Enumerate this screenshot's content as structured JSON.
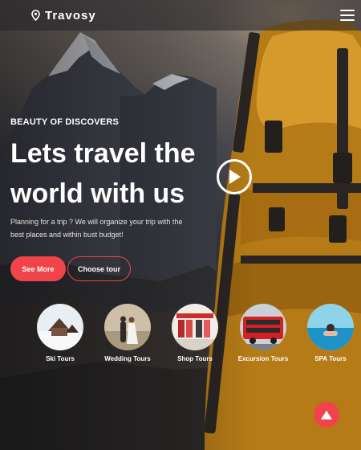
{
  "brand": {
    "name": "Travosy"
  },
  "hero": {
    "eyebrow": "BEAUTY OF DISCOVERS",
    "headline": "Lets travel the world with us",
    "description": "Planning for a trip ? We will organize your trip with the best places and within bust budget!",
    "primary_button": "See More",
    "secondary_button": "Choose tour"
  },
  "tours": [
    {
      "label": "Ski Tours",
      "icon": "ski-lodge-image"
    },
    {
      "label": "Wedding Tours",
      "icon": "wedding-couple-image"
    },
    {
      "label": "Shop Tours",
      "icon": "shop-image"
    },
    {
      "label": "Excursion Tours",
      "icon": "red-bus-image"
    },
    {
      "label": "SPA Tours",
      "icon": "pool-image"
    }
  ],
  "colors": {
    "accent": "#f0444a",
    "header_bg": "#23232a",
    "pack_orange": "#c98a1c"
  }
}
